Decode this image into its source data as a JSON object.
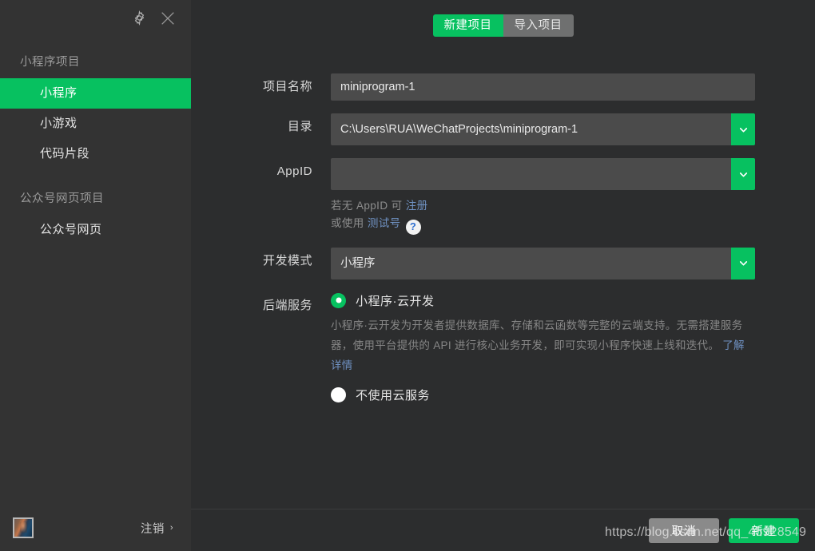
{
  "window": {
    "settings_icon": "gear-icon",
    "close_icon": "close-icon"
  },
  "sidebar": {
    "groups": [
      {
        "title": "小程序项目",
        "items": [
          {
            "label": "小程序",
            "active": true
          },
          {
            "label": "小游戏",
            "active": false
          },
          {
            "label": "代码片段",
            "active": false
          }
        ]
      },
      {
        "title": "公众号网页项目",
        "items": [
          {
            "label": "公众号网页",
            "active": false
          }
        ]
      }
    ],
    "footer": {
      "avatar": "user-avatar",
      "logout_label": "注销",
      "logout_chevron": "›"
    }
  },
  "tabs": [
    {
      "label": "新建项目",
      "active": true
    },
    {
      "label": "导入项目",
      "active": false
    }
  ],
  "form": {
    "project_name": {
      "label": "项目名称",
      "value": "miniprogram-1",
      "placeholder": ""
    },
    "directory": {
      "label": "目录",
      "value": "C:\\Users\\RUA\\WeChatProjects\\miniprogram-1",
      "placeholder": ""
    },
    "appid": {
      "label": "AppID",
      "value": "",
      "placeholder": "",
      "hint_line1_prefix": "若无 AppID 可 ",
      "hint_line1_link": "注册",
      "hint_line2_prefix": "或使用 ",
      "hint_line2_link": "测试号",
      "help_badge": "?"
    },
    "dev_mode": {
      "label": "开发模式",
      "value": "小程序"
    },
    "backend": {
      "label": "后端服务",
      "options": [
        {
          "label": "小程序·云开发",
          "selected": true,
          "description": "小程序·云开发为开发者提供数据库、存储和云函数等完整的云端支持。无需搭建服务器，使用平台提供的 API 进行核心业务开发，即可实现小程序快速上线和迭代。",
          "description_link": "了解详情"
        },
        {
          "label": "不使用云服务",
          "selected": false
        }
      ]
    }
  },
  "footer": {
    "cancel_label": "取消",
    "confirm_label": "新建"
  },
  "watermark": "https://blog.csdn.net/qq_45928549",
  "colors": {
    "accent": "#07c160",
    "sidebar_bg": "#333333",
    "main_bg": "#2c2d2e",
    "input_bg": "#4b4b4b",
    "link": "#6f91c2"
  }
}
